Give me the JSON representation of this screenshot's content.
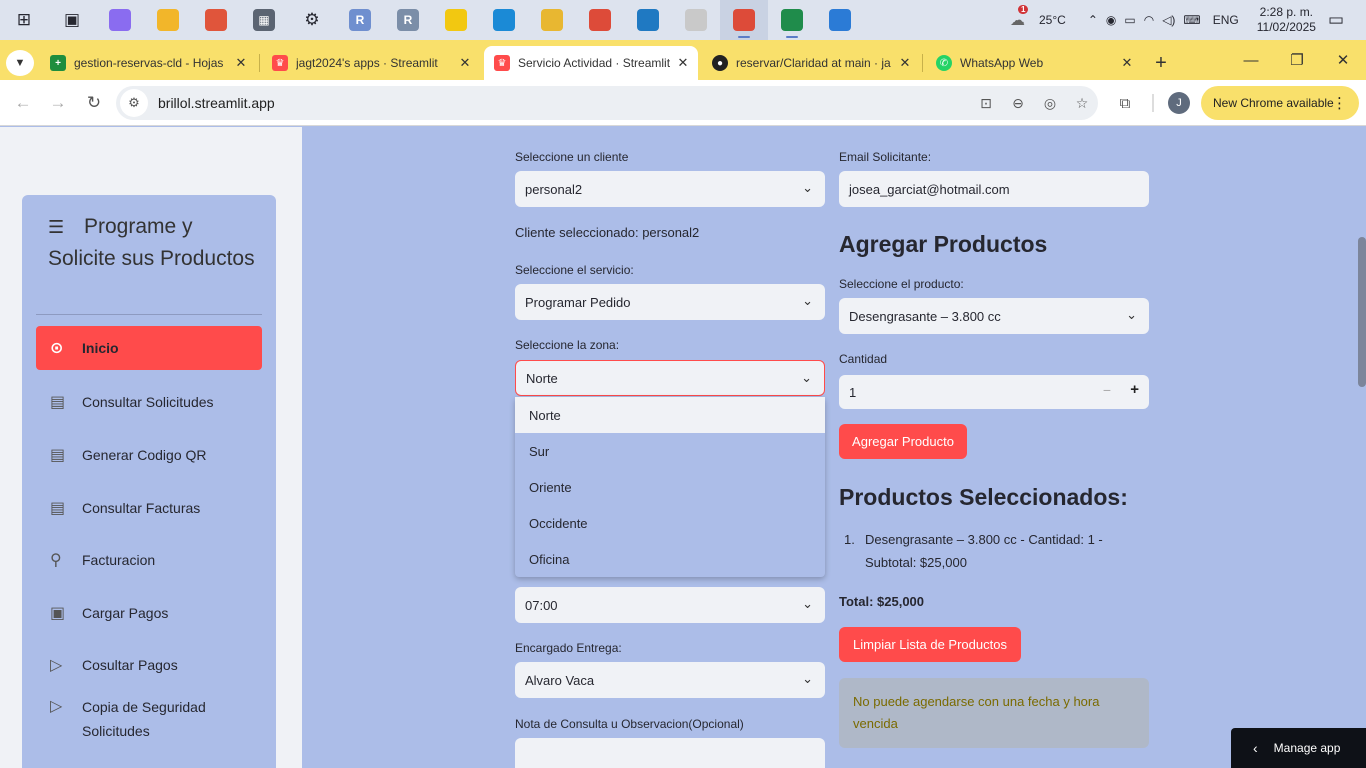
{
  "taskbar": {
    "apps": [
      {
        "name": "windows-start",
        "glyph": "⊞",
        "bg": "",
        "running": false,
        "active": false
      },
      {
        "name": "task-view",
        "glyph": "▣",
        "bg": "",
        "running": false,
        "active": false
      },
      {
        "name": "copilot",
        "glyph": "",
        "bg": "#8a6cf0",
        "running": false,
        "active": false
      },
      {
        "name": "file-explorer",
        "glyph": "",
        "bg": "#f2b62a",
        "running": false,
        "active": false
      },
      {
        "name": "paint",
        "glyph": "",
        "bg": "#e0553b",
        "running": false,
        "active": false
      },
      {
        "name": "calculator",
        "glyph": "▦",
        "bg": "#5b6472",
        "running": false,
        "active": false
      },
      {
        "name": "settings",
        "glyph": "⚙",
        "bg": "",
        "running": false,
        "active": false
      },
      {
        "name": "r-app",
        "glyph": "R",
        "bg": "#6f8fcf",
        "running": false,
        "active": false
      },
      {
        "name": "rstudio",
        "glyph": "R",
        "bg": "#7b8ea8",
        "running": false,
        "active": false
      },
      {
        "name": "power-bi",
        "glyph": "",
        "bg": "#f2c811",
        "running": false,
        "active": false
      },
      {
        "name": "edge",
        "glyph": "",
        "bg": "#1b8ad6",
        "running": false,
        "active": false
      },
      {
        "name": "python-tool",
        "glyph": "",
        "bg": "#e8b731",
        "running": false,
        "active": false
      },
      {
        "name": "chrome",
        "glyph": "",
        "bg": "#dd4b39",
        "running": false,
        "active": false
      },
      {
        "name": "vs-code",
        "glyph": "",
        "bg": "#1f79c2",
        "running": false,
        "active": false
      },
      {
        "name": "clock-app",
        "glyph": "",
        "bg": "#c9c9c9",
        "running": false,
        "active": false
      },
      {
        "name": "chrome-profile",
        "glyph": "",
        "bg": "#dd4b39",
        "running": true,
        "active": true
      },
      {
        "name": "excel",
        "glyph": "",
        "bg": "#1f8c4b",
        "running": true,
        "active": false
      },
      {
        "name": "remote-desktop",
        "glyph": "",
        "bg": "#2b7bd6",
        "running": false,
        "active": false
      }
    ],
    "weather_badge": "1",
    "temperature": "25°C",
    "language": "ENG",
    "time": "2:28 p. m.",
    "date": "11/02/2025"
  },
  "tabs": [
    {
      "title": "gestion-reservas-cld - Hojas",
      "fav_bg": "#1e8e3e",
      "fav_glyph": "+"
    },
    {
      "title": "jagt2024's apps · Streamlit",
      "fav_bg": "#ff4b4b",
      "fav_glyph": ""
    },
    {
      "title": "Servicio Actividad · Streamlit",
      "fav_bg": "#ff4b4b",
      "fav_glyph": ""
    },
    {
      "title": "reservar/Claridad at main · ja",
      "fav_bg": "#222222",
      "fav_glyph": ""
    },
    {
      "title": "WhatsApp Web",
      "fav_bg": "#25d366",
      "fav_glyph": ""
    }
  ],
  "browser": {
    "url": "brillol.streamlit.app",
    "avatar_initial": "J",
    "update_label": "New Chrome available"
  },
  "sidebar": {
    "title": "Programe y Solicite sus Productos",
    "items": [
      {
        "label": "Inicio",
        "icon": "⊙",
        "icon_name": "home-icon"
      },
      {
        "label": "Consultar Solicitudes",
        "icon": "▤",
        "icon_name": "calendar-icon"
      },
      {
        "label": "Generar Codigo QR",
        "icon": "▤",
        "icon_name": "calendar-icon"
      },
      {
        "label": "Consultar Facturas",
        "icon": "▤",
        "icon_name": "calendar-icon"
      },
      {
        "label": "Facturacion",
        "icon": "⚲",
        "icon_name": "badge-icon"
      },
      {
        "label": "Cargar Pagos",
        "icon": "▣",
        "icon_name": "clipboard-icon"
      },
      {
        "label": "Cosultar Pagos",
        "icon": "▷",
        "icon_name": "play-icon"
      },
      {
        "label": "Copia de Seguridad Solicitudes",
        "icon": "▷",
        "icon_name": "play-icon"
      }
    ]
  },
  "form": {
    "cliente_label": "Seleccione un cliente",
    "cliente_value": "personal2",
    "cliente_seleccionado": "Cliente seleccionado: personal2",
    "servicio_label": "Seleccione el servicio:",
    "servicio_value": "Programar Pedido",
    "zona_label": "Seleccione la zona:",
    "zona_value": "Norte",
    "zona_options": [
      "Norte",
      "Sur",
      "Oriente",
      "Occidente",
      "Oficina"
    ],
    "hora_value": "07:00",
    "encargado_label": "Encargado Entrega:",
    "encargado_value": "Alvaro Vaca",
    "nota_label": "Nota de Consulta u Observacion(Opcional)",
    "email_label": "Email Solicitante:",
    "email_value": "josea_garciat@hotmail.com"
  },
  "productos": {
    "heading": "Agregar Productos",
    "producto_label": "Seleccione el producto:",
    "producto_value": "Desengrasante – 3.800 cc",
    "cantidad_label": "Cantidad",
    "cantidad_value": "1",
    "minus": "−",
    "plus": "+",
    "add_button": "Agregar Producto",
    "selected_heading": "Productos Seleccionados:",
    "selected_items": [
      {
        "index": "1.",
        "line1": "Desengrasante – 3.800 cc - Cantidad: 1 -",
        "line2": "Subtotal: $25,000"
      }
    ],
    "total": "Total: $25,000",
    "clear_button": "Limpiar Lista de Productos",
    "warning": "No puede agendarse con una fecha y hora vencida"
  },
  "manage_app": "Manage app"
}
